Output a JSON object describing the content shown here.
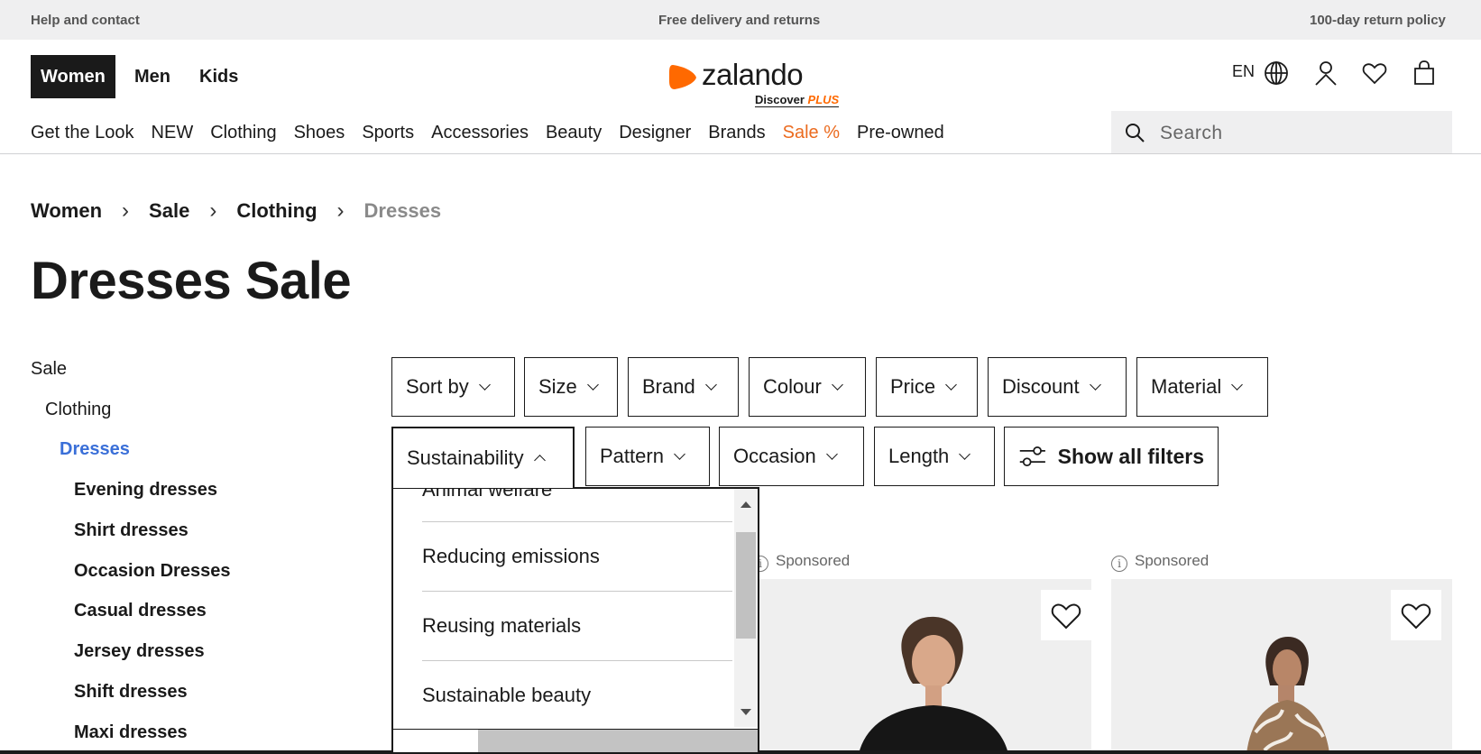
{
  "topbar": {
    "left": "Help and contact",
    "center": "Free delivery and returns",
    "right": "100-day return policy"
  },
  "header": {
    "genders": [
      "Women",
      "Men",
      "Kids"
    ],
    "logo": {
      "wordmark": "zalando",
      "discover": "Discover",
      "plus": "PLUS",
      "brand_color": "#ff6900"
    },
    "lang": "EN",
    "icons": [
      "globe-icon",
      "user-icon",
      "heart-icon",
      "bag-icon"
    ]
  },
  "catnav": [
    "Get the Look",
    "NEW",
    "Clothing",
    "Shoes",
    "Sports",
    "Accessories",
    "Beauty",
    "Designer",
    "Brands",
    "Sale %",
    "Pre-owned"
  ],
  "search": {
    "placeholder": "Search"
  },
  "breadcrumb": [
    "Women",
    "Sale",
    "Clothing",
    "Dresses"
  ],
  "page_title": "Dresses Sale",
  "sidebar": {
    "root": "Sale",
    "parent": "Clothing",
    "current": "Dresses",
    "children": [
      "Evening dresses",
      "Shirt dresses",
      "Occasion Dresses",
      "Casual dresses",
      "Jersey dresses",
      "Shift dresses",
      "Maxi dresses"
    ]
  },
  "filters_row1": [
    "Sort by",
    "Size",
    "Brand",
    "Colour",
    "Price",
    "Discount",
    "Material"
  ],
  "filters_row2": [
    "Sustainability",
    "Pattern",
    "Occasion",
    "Length"
  ],
  "show_all_filters": "Show all filters",
  "sustainability_options": [
    "Animal welfare",
    "Reducing emissions",
    "Reusing materials",
    "Sustainable beauty"
  ],
  "products": [
    {
      "label": "Sponsored"
    },
    {
      "label": "Sponsored"
    }
  ],
  "colors": {
    "accent_link": "#3a6fd8",
    "sale": "#eb6b1f",
    "text": "#1a1a1a"
  }
}
